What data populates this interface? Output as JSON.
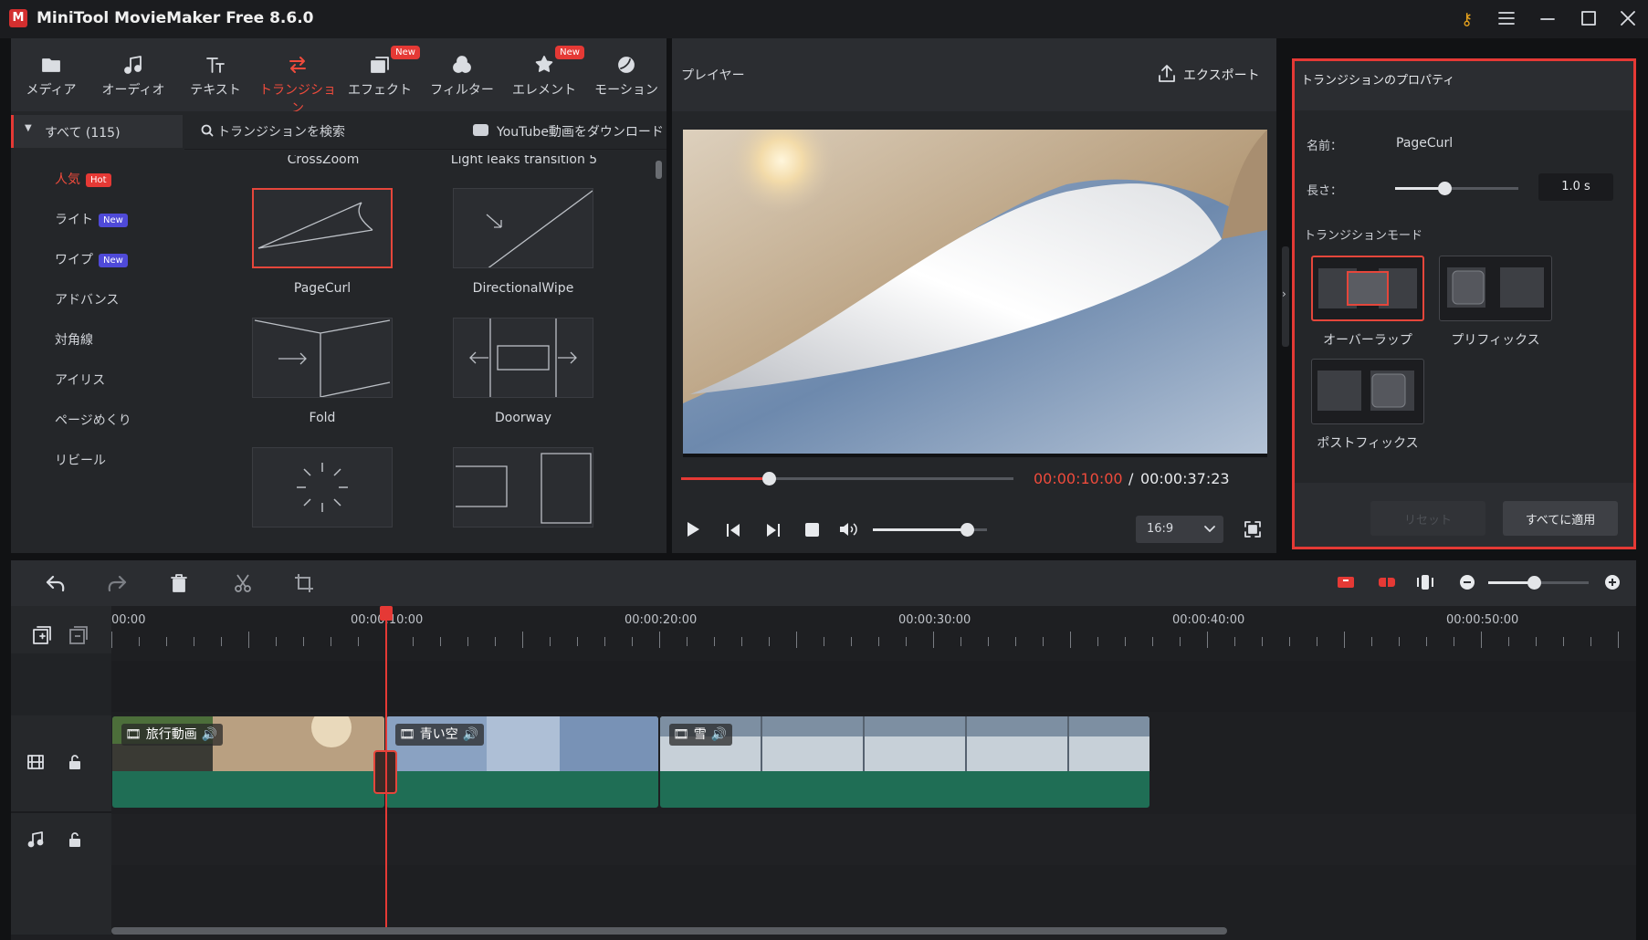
{
  "app": {
    "title": "MiniTool MovieMaker Free 8.6.0"
  },
  "colors": {
    "accent": "#e53935",
    "panel": "#242629",
    "header": "#2b2d31",
    "clip_green": "#1f6e55"
  },
  "toolbar": {
    "items": [
      {
        "label": "メディア",
        "icon": "folder-icon",
        "new": ""
      },
      {
        "label": "オーディオ",
        "icon": "music-note-icon",
        "new": ""
      },
      {
        "label": "テキスト",
        "icon": "text-icon",
        "new": ""
      },
      {
        "label": "トランジション",
        "icon": "transition-arrows-icon",
        "new": ""
      },
      {
        "label": "エフェクト",
        "icon": "effect-icon",
        "new": "New"
      },
      {
        "label": "フィルター",
        "icon": "filter-icon",
        "new": ""
      },
      {
        "label": "エレメント",
        "icon": "element-icon",
        "new": "New"
      },
      {
        "label": "モーション",
        "icon": "motion-icon",
        "new": ""
      }
    ],
    "active_index": 3
  },
  "categories": {
    "all": "すべて (115)",
    "items": [
      {
        "label": "人気",
        "badge": "Hot"
      },
      {
        "label": "ライト",
        "badge": "New"
      },
      {
        "label": "ワイプ",
        "badge": "New"
      },
      {
        "label": "アドバンス",
        "badge": ""
      },
      {
        "label": "対角線",
        "badge": ""
      },
      {
        "label": "アイリス",
        "badge": ""
      },
      {
        "label": "ページめくり",
        "badge": ""
      },
      {
        "label": "リビール",
        "badge": ""
      }
    ]
  },
  "gallery": {
    "search_placeholder": "トランジションを検索",
    "youtube": "YouTube動画をダウンロード",
    "cut_top": [
      "CrossZoom",
      "Light leaks transition 5"
    ],
    "items": [
      "PageCurl",
      "DirectionalWipe",
      "Fold",
      "Doorway"
    ]
  },
  "player": {
    "label": "プレイヤー",
    "export": "エクスポート",
    "time_current": "00:00:10:00",
    "time_sep": "/",
    "time_total": "00:00:37:23",
    "progress": 0.265,
    "volume": 0.82,
    "aspect": "16:9"
  },
  "props": {
    "title": "トランジションのプロパティ",
    "name_label": "名前：",
    "name_value": "PageCurl",
    "length_label": "長さ：",
    "length_value": "1.0 s",
    "length_slider": 0.4,
    "mode_title": "トランジションモード",
    "modes": [
      "オーバーラップ",
      "プリフィックス",
      "ポストフィックス"
    ],
    "reset": "リセット",
    "apply_all": "すべてに適用"
  },
  "timeline": {
    "ruler": [
      "00:00",
      "00:00:10:00",
      "00:00:20:00",
      "00:00:30:00",
      "00:00:40:00",
      "00:00:50:00"
    ],
    "clips": [
      "旅行動画",
      "青い空",
      "雪"
    ],
    "zoom": 0.45
  }
}
